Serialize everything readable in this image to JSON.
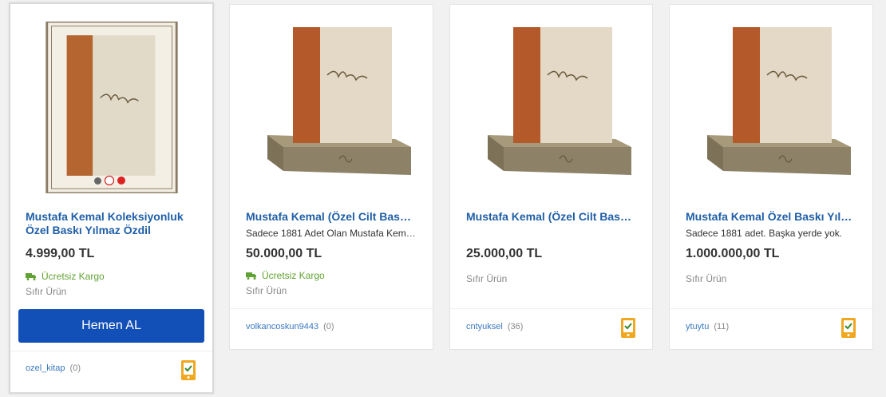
{
  "cards": [
    {
      "title": "Mustafa Kemal Koleksiyonluk Özel Baskı Yılmaz Özdil",
      "description": "",
      "price": "4.999,00 TL",
      "cargo": "Ücretsiz Kargo",
      "condition": "Sıfır Ürün",
      "seller": "ozel_kitap",
      "seller_count": "(0)",
      "buy_label": "Hemen AL"
    },
    {
      "title": "Mustafa Kemal (Özel Cilt Bas…",
      "description": "Sadece 1881 Adet Olan Mustafa Kem…",
      "price": "50.000,00 TL",
      "cargo": "Ücretsiz Kargo",
      "condition": "Sıfır Ürün",
      "seller": "volkancoskun9443",
      "seller_count": "(0)"
    },
    {
      "title": "Mustafa Kemal (Özel Cilt Bas…",
      "description": "",
      "price": "25.000,00 TL",
      "condition": "Sıfır Ürün",
      "seller": "cntyuksel",
      "seller_count": "(36)"
    },
    {
      "title": "Mustafa Kemal Özel Baskı Yıl…",
      "description": "Sadece 1881 adet. Başka yerde yok.",
      "price": "1.000.000,00 TL",
      "condition": "Sıfır Ürün",
      "seller": "ytuytu",
      "seller_count": "(11)"
    }
  ],
  "colors": {
    "accent": "#1250b8",
    "link": "#1f5fa8",
    "free_cargo": "#60a233",
    "mobile_badge": "#f0a820"
  },
  "icons": [
    "truck-icon",
    "mobile-verified-icon",
    "carousel-dot-icon"
  ]
}
